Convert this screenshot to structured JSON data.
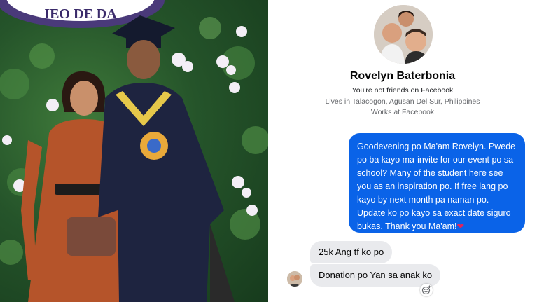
{
  "photo": {
    "banner_text": "IEO DE DA",
    "icon": "graduation-photo"
  },
  "profile": {
    "name": "Rovelyn Baterbonia",
    "friend_status": "You're not friends on Facebook",
    "lives": "Lives in Talacogon, Agusan Del Sur, Philippines",
    "works": "Works at Facebook"
  },
  "messages": {
    "outgoing": "Goodevening po Ma'am Rovelyn. Pwede po ba kayo ma-invite for our event po sa school? Many of the student here see you as an inspiration po. If free lang po kayo by next month pa naman po. Update ko po kayo sa exact date siguro bukas. Thank you Ma'am!",
    "outgoing_emoji": "❤",
    "incoming_1": "25k Ang tf ko po",
    "incoming_2": "Donation po Yan sa anak ko"
  },
  "colors": {
    "outgoing_bubble": "#0a63e8",
    "incoming_bubble": "#e9eaed"
  }
}
